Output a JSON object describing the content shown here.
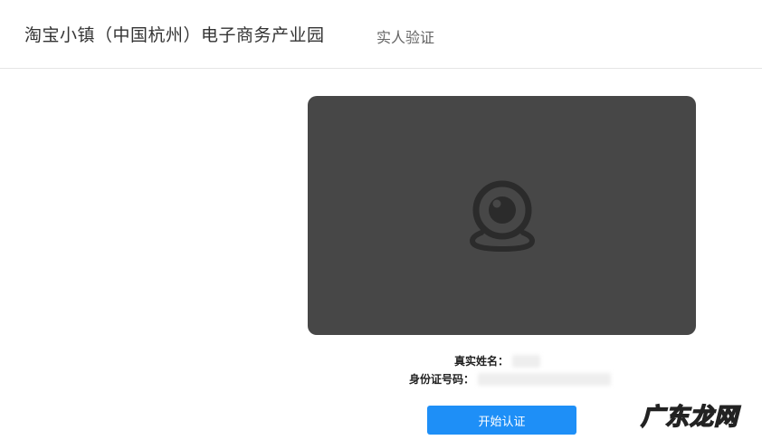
{
  "header": {
    "site_title": "淘宝小镇（中国杭州）电子商务产业园",
    "page_subtitle": "实人验证"
  },
  "camera": {
    "icon": "webcam-icon",
    "panel_color": "#474747"
  },
  "info": {
    "name_label": "真实姓名：",
    "name_value": "●●●",
    "id_label": "身份证号码：",
    "id_value": "●●●●●●●●●●●●●●"
  },
  "actions": {
    "start_label": "开始认证",
    "start_color": "#1e8ff7"
  },
  "watermark": {
    "text": "广东龙网"
  }
}
